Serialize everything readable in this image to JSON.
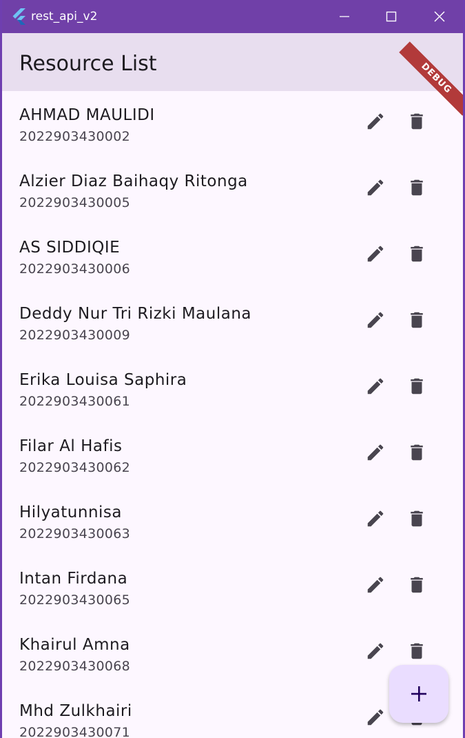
{
  "window": {
    "title": "rest_api_v2",
    "colors": {
      "titlebar": "#7040a8",
      "appbar": "#e8deef",
      "fab": "#eaddff"
    }
  },
  "appbar": {
    "title": "Resource List",
    "debug_banner": "DEBUG"
  },
  "items": [
    {
      "name": "AHMAD MAULIDI",
      "id": "2022903430002"
    },
    {
      "name": "Alzier Diaz Baihaqy Ritonga",
      "id": "2022903430005"
    },
    {
      "name": "AS SIDDIQIE",
      "id": "2022903430006"
    },
    {
      "name": "Deddy Nur Tri Rizki Maulana",
      "id": "2022903430009"
    },
    {
      "name": "Erika Louisa Saphira",
      "id": "2022903430061"
    },
    {
      "name": "Filar Al Hafis",
      "id": "2022903430062"
    },
    {
      "name": "Hilyatunnisa",
      "id": "2022903430063"
    },
    {
      "name": "Intan Firdana",
      "id": "2022903430065"
    },
    {
      "name": "Khairul Amna",
      "id": "2022903430068"
    },
    {
      "name": "Mhd Zulkhairi",
      "id": "2022903430071"
    }
  ],
  "icons": {
    "edit": "pencil-icon",
    "delete": "trash-icon",
    "add": "plus-icon"
  }
}
